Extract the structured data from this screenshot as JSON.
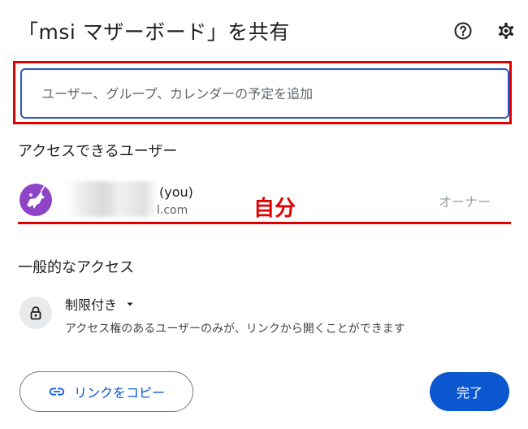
{
  "header": {
    "title": "「msi マザーボード」を共有",
    "help_icon": "help-circle-icon",
    "settings_icon": "gear-icon"
  },
  "share_input": {
    "placeholder": "ユーザー、グループ、カレンダーの予定を追加",
    "value": ""
  },
  "people": {
    "heading": "アクセスできるユーザー",
    "items": [
      {
        "name_suffix": "(you)",
        "email_suffix": "l.com",
        "role": "オーナー",
        "avatar_icon": "unicorn-avatar-icon"
      }
    ]
  },
  "annotation": {
    "label": "自分",
    "color": "#e00000"
  },
  "general_access": {
    "heading": "一般的なアクセス",
    "level": "制限付き",
    "description": "アクセス権のあるユーザーのみが、リンクから開くことができます",
    "icon": "lock-icon"
  },
  "footer": {
    "copy_link_label": "リンクをコピー",
    "copy_link_icon": "link-icon",
    "done_label": "完了"
  },
  "colors": {
    "accent": "#0b57d0",
    "input_border": "#2c55c8",
    "avatar_bg": "#8e44c7"
  }
}
